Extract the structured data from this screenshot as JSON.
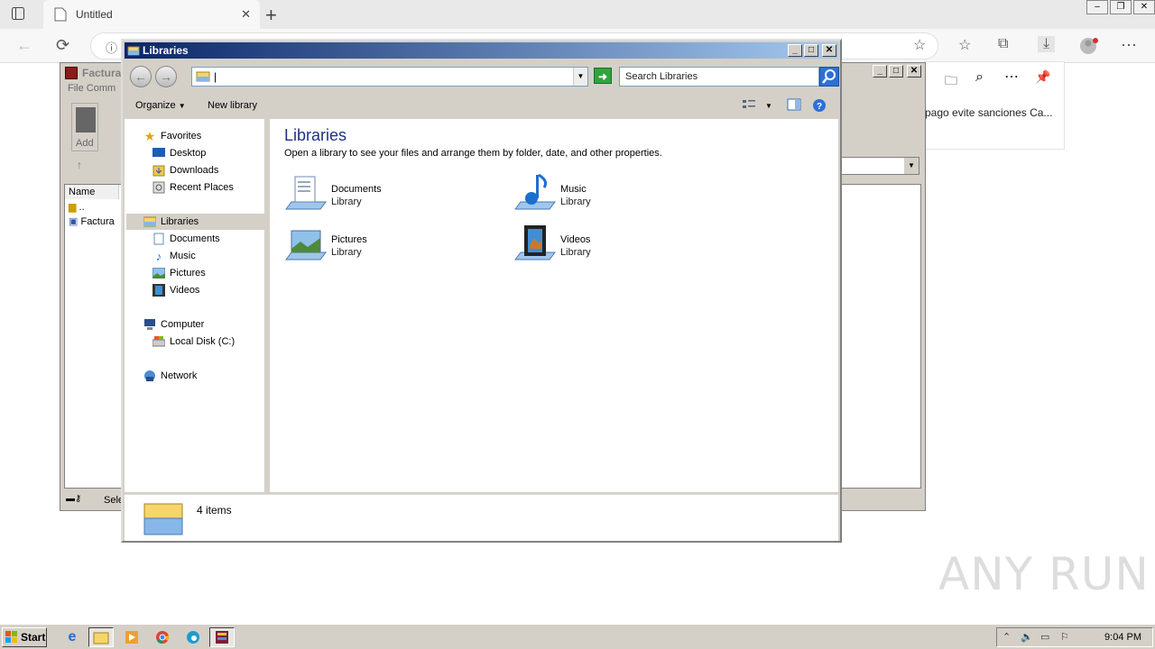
{
  "browser": {
    "tab_title": "Untitled",
    "tab_close": "✕",
    "new_tab": "+",
    "side_panel_text": "pago evite sanciones Ca..."
  },
  "winrar": {
    "title": "Factura",
    "menu": "File  Comm",
    "add_label": "Add",
    "col_name": "Name",
    "row_parent": "..",
    "row_file": "Factura",
    "status": "Sele"
  },
  "explorer": {
    "title": "Libraries",
    "address_value": "|",
    "search_placeholder": "Search Libraries",
    "organize": "Organize",
    "new_library": "New library",
    "heading": "Libraries",
    "description": "Open a library to see your files and arrange them by folder, date, and other properties.",
    "nav": {
      "favorites": "Favorites",
      "desktop": "Desktop",
      "downloads": "Downloads",
      "recent_places": "Recent Places",
      "libraries": "Libraries",
      "documents": "Documents",
      "music": "Music",
      "pictures": "Pictures",
      "videos": "Videos",
      "computer": "Computer",
      "local_disk": "Local Disk (C:)",
      "network": "Network"
    },
    "libraries": [
      {
        "name": "Documents",
        "type": "Library"
      },
      {
        "name": "Music",
        "type": "Library"
      },
      {
        "name": "Pictures",
        "type": "Library"
      },
      {
        "name": "Videos",
        "type": "Library"
      }
    ],
    "item_count": "4 items"
  },
  "taskbar": {
    "start": "Start",
    "clock": "9:04 PM"
  },
  "watermark": "ANY RUN",
  "colors": {
    "title_bar": "#0a246a",
    "heading": "#1e3287",
    "classic_face": "#d4d0c8"
  }
}
